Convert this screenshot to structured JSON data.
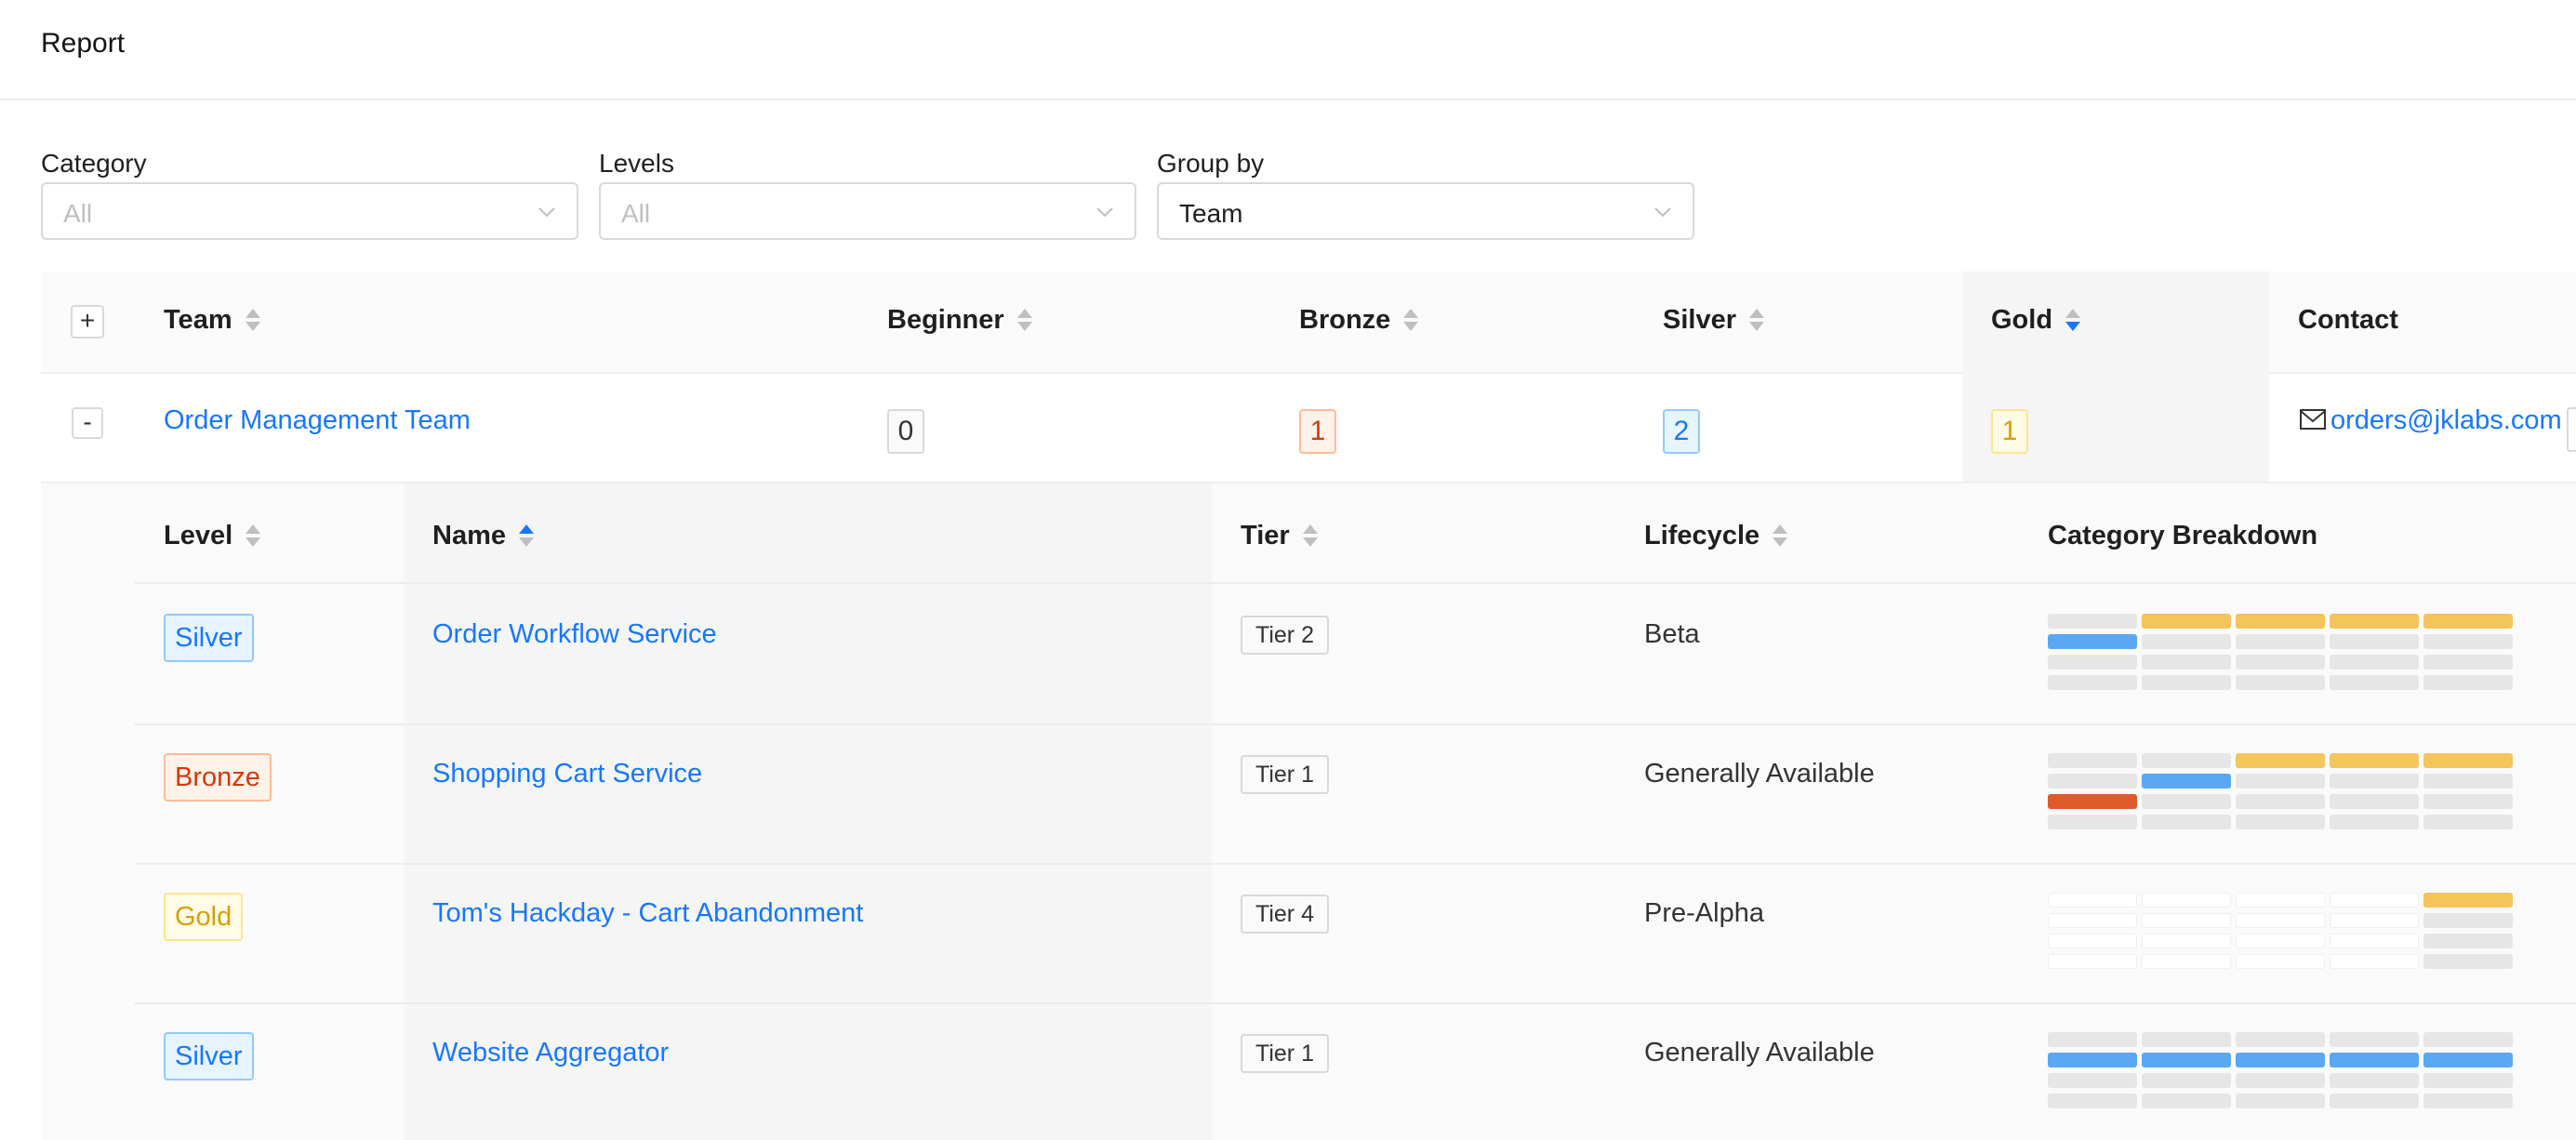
{
  "page": {
    "title": "Report"
  },
  "filters": [
    {
      "label": "Category",
      "value": "All",
      "placeholder": true
    },
    {
      "label": "Levels",
      "value": "All",
      "placeholder": true
    },
    {
      "label": "Group by",
      "value": "Team",
      "placeholder": false
    }
  ],
  "table": {
    "columns": [
      "Team",
      "Beginner",
      "Bronze",
      "Silver",
      "Gold",
      "Contact"
    ],
    "sorted_column": "Gold",
    "sort_direction": "desc",
    "expand_all_symbol": "+",
    "collapse_symbol": "-",
    "rows": [
      {
        "team": "Order Management Team",
        "beginner": "0",
        "bronze": "1",
        "silver": "2",
        "gold": "1",
        "contact": "orders@jklabs.com"
      }
    ]
  },
  "nested": {
    "columns": [
      "Level",
      "Name",
      "Tier",
      "Lifecycle",
      "Category Breakdown"
    ],
    "sorted_column": "Name",
    "sort_direction": "asc",
    "rows": [
      {
        "level": "Silver",
        "name": "Order Workflow Service",
        "tier": "Tier 2",
        "lifecycle": "Beta",
        "breakdown": [
          [
            "empty",
            "gold",
            "gold",
            "gold",
            "gold"
          ],
          [
            "silver",
            "empty",
            "empty",
            "empty",
            "empty"
          ],
          [
            "empty",
            "empty",
            "empty",
            "empty",
            "empty"
          ],
          [
            "empty",
            "empty",
            "empty",
            "empty",
            "empty"
          ]
        ]
      },
      {
        "level": "Bronze",
        "name": "Shopping Cart Service",
        "tier": "Tier 1",
        "lifecycle": "Generally Available",
        "breakdown": [
          [
            "empty",
            "empty",
            "gold",
            "gold",
            "gold"
          ],
          [
            "empty",
            "silver",
            "empty",
            "empty",
            "empty"
          ],
          [
            "bronze",
            "empty",
            "empty",
            "empty",
            "empty"
          ],
          [
            "empty",
            "empty",
            "empty",
            "empty",
            "empty"
          ]
        ]
      },
      {
        "level": "Gold",
        "name": "Tom's Hackday - Cart Abandonment",
        "tier": "Tier 4",
        "lifecycle": "Pre-Alpha",
        "breakdown": [
          [
            "none",
            "none",
            "none",
            "none",
            "gold"
          ],
          [
            "none",
            "none",
            "none",
            "none",
            "empty"
          ],
          [
            "none",
            "none",
            "none",
            "none",
            "empty"
          ],
          [
            "none",
            "none",
            "none",
            "none",
            "empty"
          ]
        ]
      },
      {
        "level": "Silver",
        "name": "Website Aggregator",
        "tier": "Tier 1",
        "lifecycle": "Generally Available",
        "breakdown": [
          [
            "empty",
            "empty",
            "empty",
            "empty",
            "empty"
          ],
          [
            "silver",
            "silver",
            "silver",
            "silver",
            "silver"
          ],
          [
            "empty",
            "empty",
            "empty",
            "empty",
            "empty"
          ],
          [
            "empty",
            "empty",
            "empty",
            "empty",
            "empty"
          ]
        ]
      }
    ]
  },
  "colors": {
    "link": "#1677ff",
    "beginner": {
      "border": "#d9d9d9",
      "bg": "#fafafa",
      "text": "#333333"
    },
    "bronze": {
      "border": "#ffbb96",
      "bg": "#fff2e8",
      "text": "#d4380d"
    },
    "silver": {
      "border": "#91caff",
      "bg": "#e6f4ff",
      "text": "#1677ff"
    },
    "gold": {
      "border": "#ffe58f",
      "bg": "#fffbe6",
      "text": "#d4a106"
    },
    "grid": {
      "gold": "#f4c55b",
      "silver": "#5ba8f2",
      "bronze": "#e05a2c",
      "empty": "#e6e6e6",
      "none": "#ffffff"
    }
  }
}
